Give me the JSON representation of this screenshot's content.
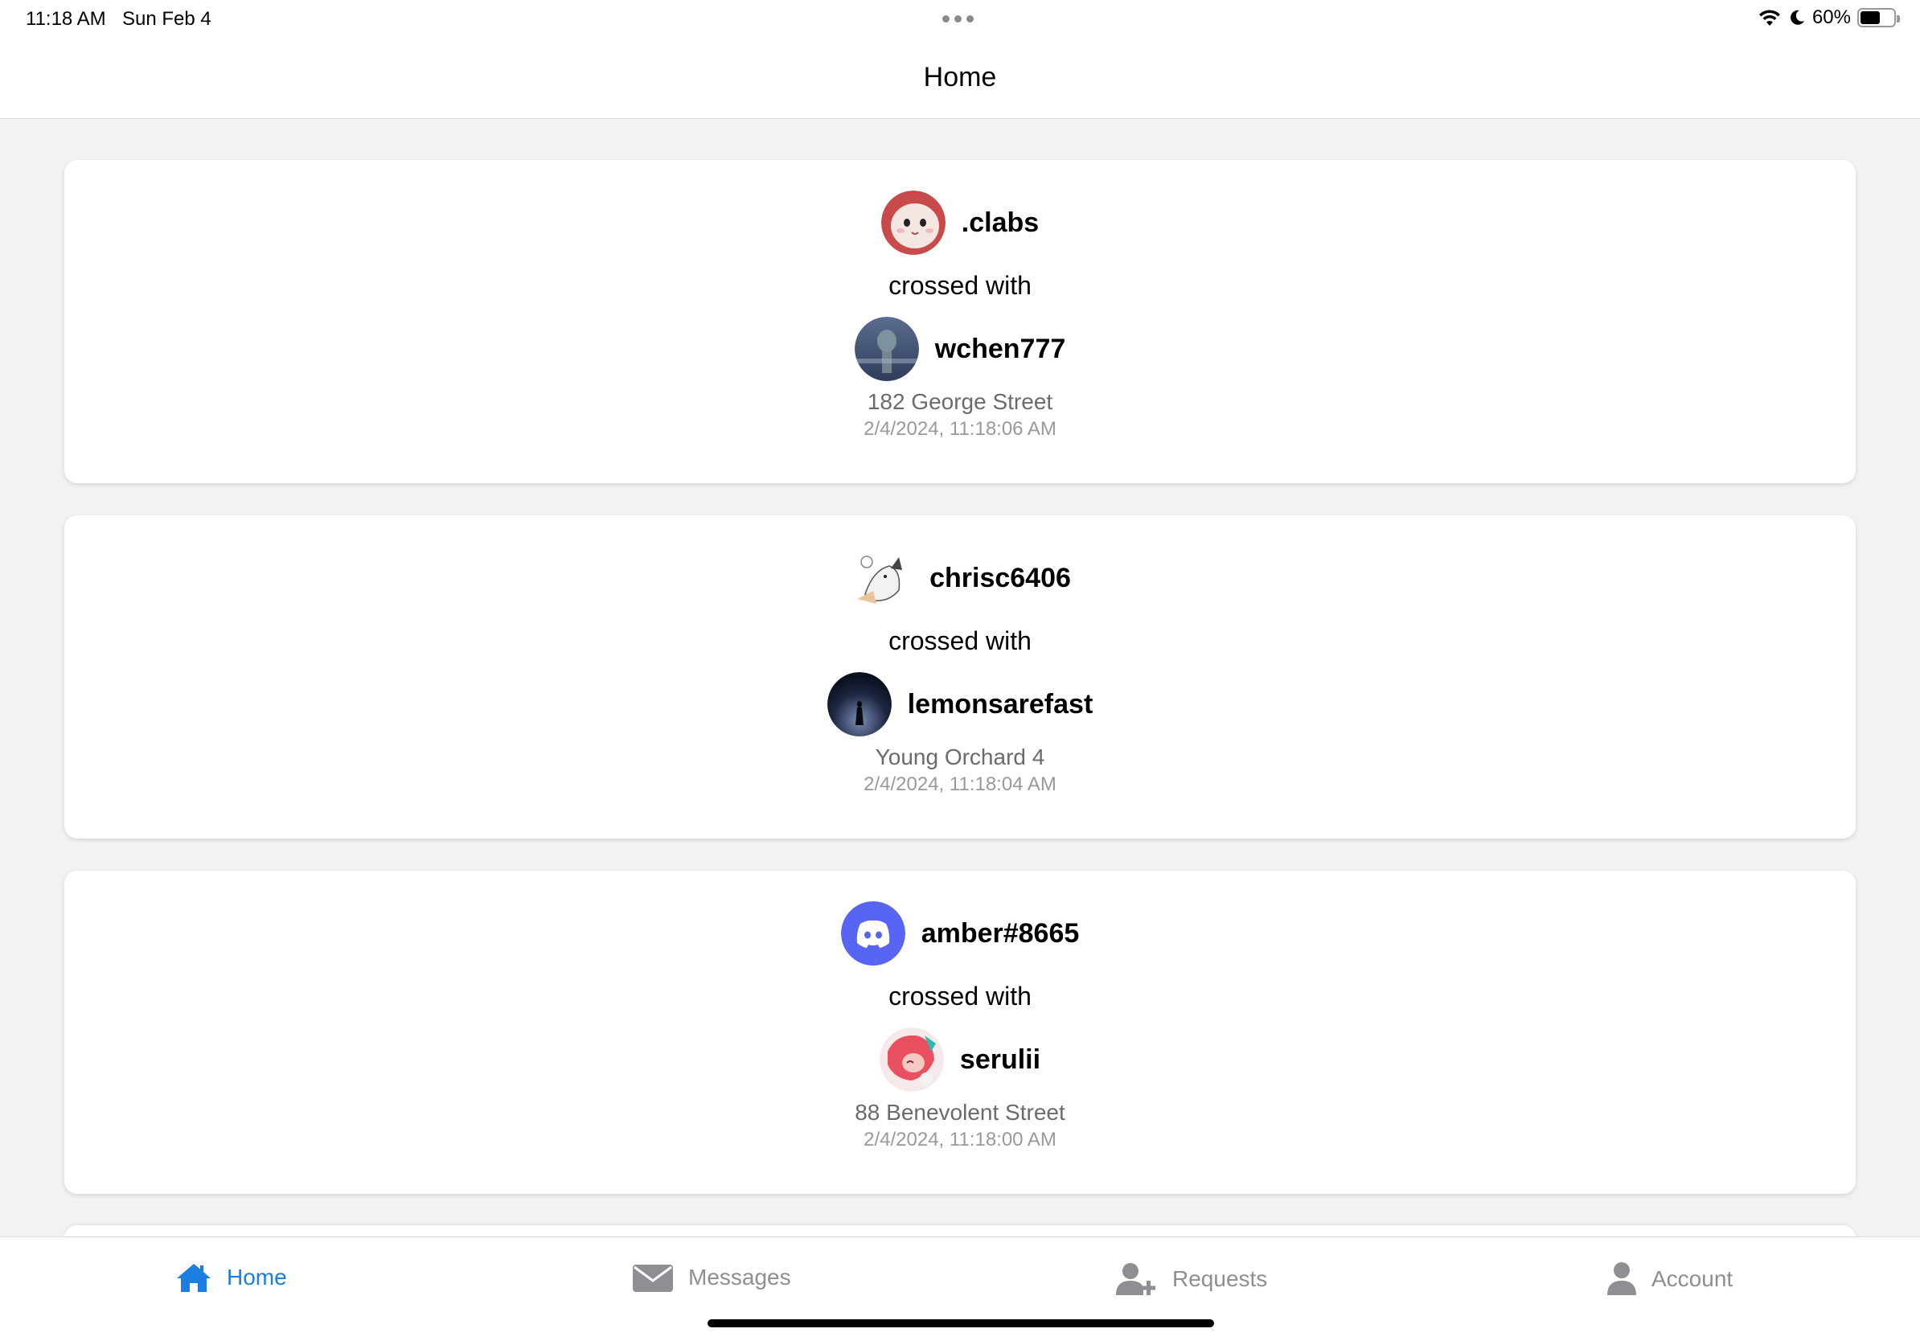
{
  "status_bar": {
    "time": "11:18 AM",
    "date": "Sun Feb 4",
    "battery": "60%",
    "battery_level": 0.6,
    "icons": [
      "wifi-icon",
      "moon-icon",
      "battery-icon"
    ]
  },
  "nav": {
    "title": "Home"
  },
  "feed": [
    {
      "user1": "clabs",
      "user1_prefix": ".",
      "crossed_text": "crossed with",
      "user2": "wchen777",
      "location": "182 George Street",
      "timestamp": "2/4/2024, 11:18:06 AM"
    },
    {
      "user1": "chrisc6406",
      "user1_prefix": "",
      "crossed_text": "crossed with",
      "user2": "lemonsarefast",
      "location": "Young Orchard 4",
      "timestamp": "2/4/2024, 11:18:04 AM"
    },
    {
      "user1": "amber#8665",
      "user1_prefix": "",
      "crossed_text": "crossed with",
      "user2": "serulii",
      "location": "88 Benevolent Street",
      "timestamp": "2/4/2024, 11:18:00 AM"
    }
  ],
  "tabs": [
    {
      "label": "Home",
      "icon": "home-icon",
      "active": true
    },
    {
      "label": "Messages",
      "icon": "envelope-icon",
      "active": false
    },
    {
      "label": "Requests",
      "icon": "add-user-icon",
      "active": false
    },
    {
      "label": "Account",
      "icon": "person-icon",
      "active": false
    }
  ],
  "colors": {
    "accent": "#1a7fe0",
    "inactive": "#8e8e93",
    "discord": "#5865f2"
  }
}
